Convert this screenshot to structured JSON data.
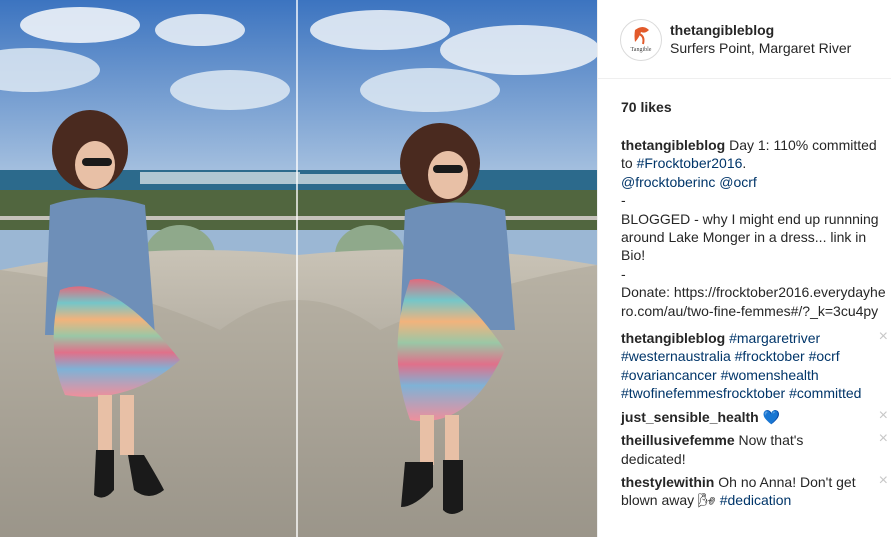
{
  "post": {
    "username": "thetangibleblog",
    "location": "Surfers Point, Margaret River",
    "likes": "70 likes"
  },
  "caption": {
    "username": "thetangibleblog",
    "text1": "Day 1: 110% committed to",
    "tag1": "#Frocktober2016",
    "text2": ".",
    "mention1": "@frocktoberinc",
    "mention2": "@ocrf",
    "dash1": "-",
    "text3": "BLOGGED - why I might end up runnning around Lake Monger in a dress... link in Bio!",
    "dash2": "-",
    "text4": "Donate: https://frocktober2016.everydayhero.com/au/two-fine-femmes#/?_k=3cu4py"
  },
  "comments": [
    {
      "username": "thetangibleblog",
      "tags": [
        "#margaretriver",
        "#westernaustralia",
        "#frocktober",
        "#ocrf",
        "#ovariancancer",
        "#womenshealth",
        "#twofinefemmesfrocktober",
        "#committed"
      ]
    },
    {
      "username": "just_sensible_health",
      "emoji": "💙"
    },
    {
      "username": "theillusivefemme",
      "text": "Now that's dedicated!"
    },
    {
      "username": "thestylewithin",
      "text": "Oh no Anna! Don't get blown away",
      "emoji": "🌬",
      "tag": "#dedication"
    }
  ],
  "icons": {
    "close": "×"
  }
}
